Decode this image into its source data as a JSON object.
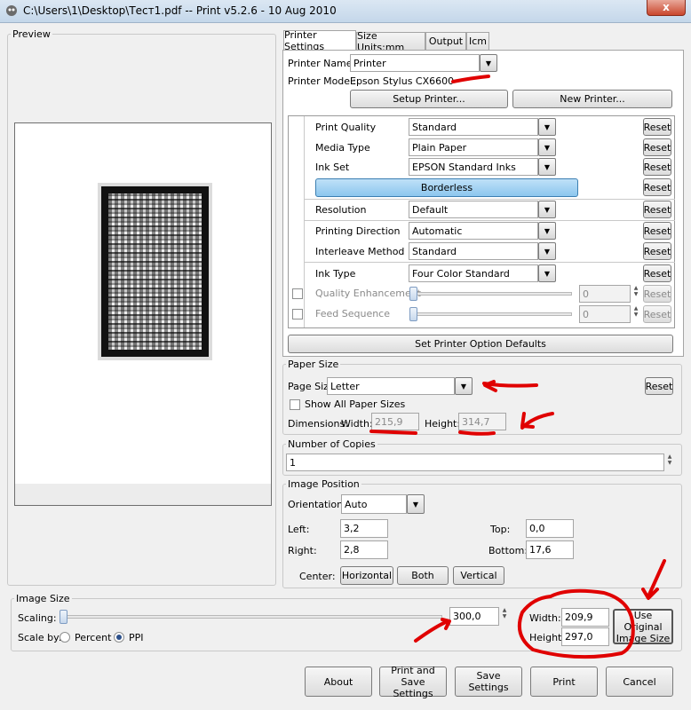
{
  "window": {
    "title": "C:\\Users\\1\\Desktop\\Тест1.pdf -- Print v5.2.6 - 10 Aug 2010",
    "close": "x"
  },
  "preview": {
    "legend": "Preview"
  },
  "tabs": [
    "Printer Settings",
    "Size Units:mm",
    "Output",
    "Icm"
  ],
  "printer": {
    "name_label": "Printer Name:",
    "name_value": "Printer",
    "model_label": "Printer Model:",
    "model_value": "Epson Stylus CX6600",
    "setup_button": "Setup Printer...",
    "new_button": "New Printer..."
  },
  "options": {
    "print_quality": {
      "label": "Print Quality",
      "value": "Standard"
    },
    "media_type": {
      "label": "Media Type",
      "value": "Plain Paper"
    },
    "ink_set": {
      "label": "Ink Set",
      "value": "EPSON Standard Inks"
    },
    "borderless": "Borderless",
    "resolution": {
      "label": "Resolution",
      "value": "Default"
    },
    "printing_direction": {
      "label": "Printing Direction",
      "value": "Automatic"
    },
    "interleave_method": {
      "label": "Interleave Method",
      "value": "Standard"
    },
    "ink_type": {
      "label": "Ink Type",
      "value": "Four Color Standard"
    },
    "quality_enhancement": {
      "label": "Quality Enhancement",
      "value": "0"
    },
    "feed_sequence": {
      "label": "Feed Sequence",
      "value": "0"
    },
    "reset": "Reset",
    "defaults_button": "Set Printer Option Defaults"
  },
  "paper": {
    "legend": "Paper Size",
    "size_label": "Page Size",
    "size_value": "Letter",
    "reset": "Reset",
    "show_all": "Show All Paper Sizes",
    "dimensions_label": "Dimensions:",
    "width_label": "Width:",
    "width_value": "215,9",
    "height_label": "Height:",
    "height_value": "314,7"
  },
  "copies": {
    "legend": "Number of Copies",
    "value": "1"
  },
  "position": {
    "legend": "Image Position",
    "orientation_label": "Orientation:",
    "orientation_value": "Auto",
    "left_label": "Left:",
    "left_value": "3,2",
    "top_label": "Top:",
    "top_value": "0,0",
    "right_label": "Right:",
    "right_value": "2,8",
    "bottom_label": "Bottom:",
    "bottom_value": "17,6",
    "center_label": "Center:",
    "horizontal": "Horizontal",
    "both": "Both",
    "vertical": "Vertical"
  },
  "image_size": {
    "legend": "Image Size",
    "scaling_label": "Scaling:",
    "scaling_value": "300,0",
    "scale_by_label": "Scale by:",
    "percent": "Percent",
    "ppi": "PPI",
    "width_label": "Width:",
    "width_value": "209,9",
    "height_label": "Height:",
    "height_value": "297,0",
    "original_button": "Use Original Image Size"
  },
  "footer": {
    "about": "About",
    "print_save": "Print and Save Settings",
    "save": "Save Settings",
    "print": "Print",
    "cancel": "Cancel"
  },
  "colors": {
    "annotation": "#e00000",
    "borderless_button": "#8cc6ee",
    "title_bar": "#c4d7ea"
  }
}
